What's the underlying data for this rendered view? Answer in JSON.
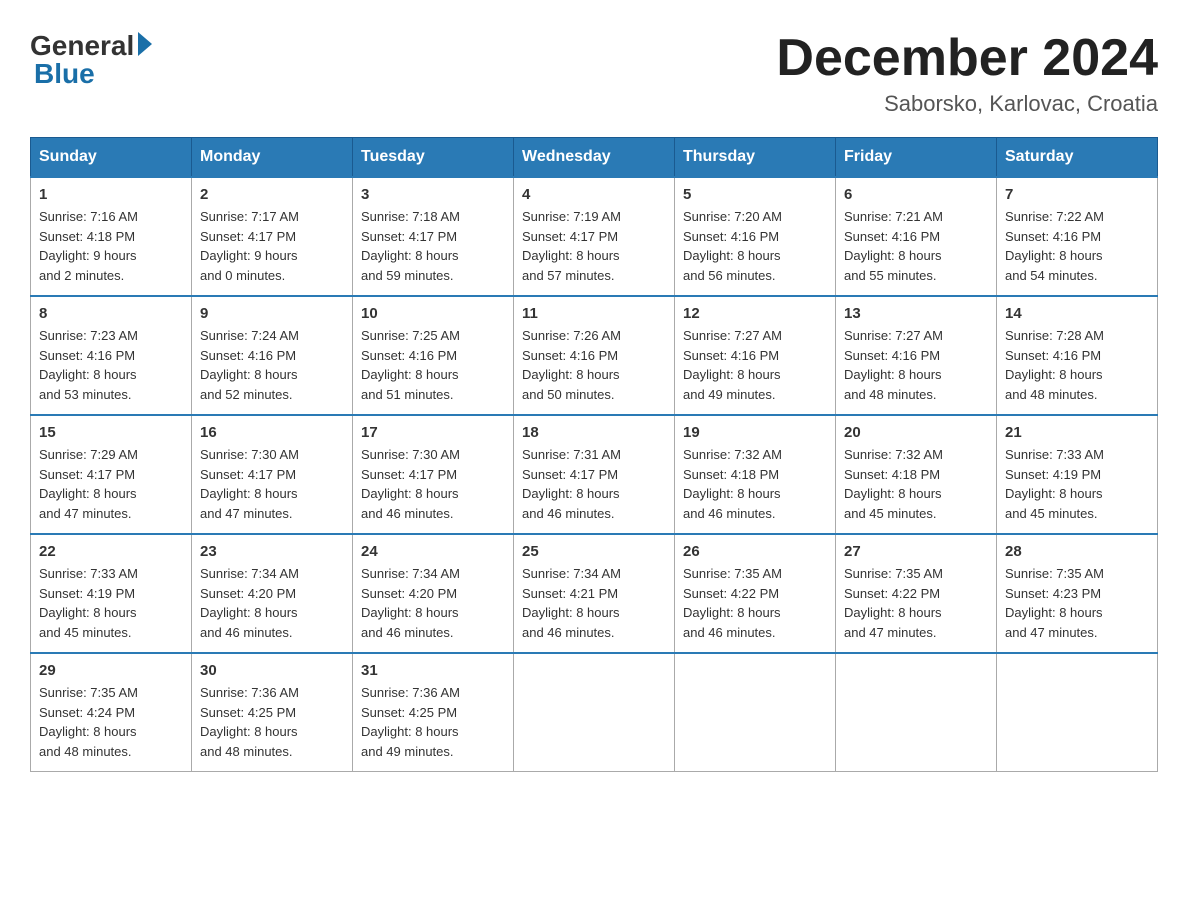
{
  "logo": {
    "general": "General",
    "blue": "Blue"
  },
  "title": {
    "month_year": "December 2024",
    "location": "Saborsko, Karlovac, Croatia"
  },
  "days_of_week": [
    "Sunday",
    "Monday",
    "Tuesday",
    "Wednesday",
    "Thursday",
    "Friday",
    "Saturday"
  ],
  "weeks": [
    [
      {
        "day": "1",
        "sunrise": "7:16 AM",
        "sunset": "4:18 PM",
        "daylight": "9 hours and 2 minutes."
      },
      {
        "day": "2",
        "sunrise": "7:17 AM",
        "sunset": "4:17 PM",
        "daylight": "9 hours and 0 minutes."
      },
      {
        "day": "3",
        "sunrise": "7:18 AM",
        "sunset": "4:17 PM",
        "daylight": "8 hours and 59 minutes."
      },
      {
        "day": "4",
        "sunrise": "7:19 AM",
        "sunset": "4:17 PM",
        "daylight": "8 hours and 57 minutes."
      },
      {
        "day": "5",
        "sunrise": "7:20 AM",
        "sunset": "4:16 PM",
        "daylight": "8 hours and 56 minutes."
      },
      {
        "day": "6",
        "sunrise": "7:21 AM",
        "sunset": "4:16 PM",
        "daylight": "8 hours and 55 minutes."
      },
      {
        "day": "7",
        "sunrise": "7:22 AM",
        "sunset": "4:16 PM",
        "daylight": "8 hours and 54 minutes."
      }
    ],
    [
      {
        "day": "8",
        "sunrise": "7:23 AM",
        "sunset": "4:16 PM",
        "daylight": "8 hours and 53 minutes."
      },
      {
        "day": "9",
        "sunrise": "7:24 AM",
        "sunset": "4:16 PM",
        "daylight": "8 hours and 52 minutes."
      },
      {
        "day": "10",
        "sunrise": "7:25 AM",
        "sunset": "4:16 PM",
        "daylight": "8 hours and 51 minutes."
      },
      {
        "day": "11",
        "sunrise": "7:26 AM",
        "sunset": "4:16 PM",
        "daylight": "8 hours and 50 minutes."
      },
      {
        "day": "12",
        "sunrise": "7:27 AM",
        "sunset": "4:16 PM",
        "daylight": "8 hours and 49 minutes."
      },
      {
        "day": "13",
        "sunrise": "7:27 AM",
        "sunset": "4:16 PM",
        "daylight": "8 hours and 48 minutes."
      },
      {
        "day": "14",
        "sunrise": "7:28 AM",
        "sunset": "4:16 PM",
        "daylight": "8 hours and 48 minutes."
      }
    ],
    [
      {
        "day": "15",
        "sunrise": "7:29 AM",
        "sunset": "4:17 PM",
        "daylight": "8 hours and 47 minutes."
      },
      {
        "day": "16",
        "sunrise": "7:30 AM",
        "sunset": "4:17 PM",
        "daylight": "8 hours and 47 minutes."
      },
      {
        "day": "17",
        "sunrise": "7:30 AM",
        "sunset": "4:17 PM",
        "daylight": "8 hours and 46 minutes."
      },
      {
        "day": "18",
        "sunrise": "7:31 AM",
        "sunset": "4:17 PM",
        "daylight": "8 hours and 46 minutes."
      },
      {
        "day": "19",
        "sunrise": "7:32 AM",
        "sunset": "4:18 PM",
        "daylight": "8 hours and 46 minutes."
      },
      {
        "day": "20",
        "sunrise": "7:32 AM",
        "sunset": "4:18 PM",
        "daylight": "8 hours and 45 minutes."
      },
      {
        "day": "21",
        "sunrise": "7:33 AM",
        "sunset": "4:19 PM",
        "daylight": "8 hours and 45 minutes."
      }
    ],
    [
      {
        "day": "22",
        "sunrise": "7:33 AM",
        "sunset": "4:19 PM",
        "daylight": "8 hours and 45 minutes."
      },
      {
        "day": "23",
        "sunrise": "7:34 AM",
        "sunset": "4:20 PM",
        "daylight": "8 hours and 46 minutes."
      },
      {
        "day": "24",
        "sunrise": "7:34 AM",
        "sunset": "4:20 PM",
        "daylight": "8 hours and 46 minutes."
      },
      {
        "day": "25",
        "sunrise": "7:34 AM",
        "sunset": "4:21 PM",
        "daylight": "8 hours and 46 minutes."
      },
      {
        "day": "26",
        "sunrise": "7:35 AM",
        "sunset": "4:22 PM",
        "daylight": "8 hours and 46 minutes."
      },
      {
        "day": "27",
        "sunrise": "7:35 AM",
        "sunset": "4:22 PM",
        "daylight": "8 hours and 47 minutes."
      },
      {
        "day": "28",
        "sunrise": "7:35 AM",
        "sunset": "4:23 PM",
        "daylight": "8 hours and 47 minutes."
      }
    ],
    [
      {
        "day": "29",
        "sunrise": "7:35 AM",
        "sunset": "4:24 PM",
        "daylight": "8 hours and 48 minutes."
      },
      {
        "day": "30",
        "sunrise": "7:36 AM",
        "sunset": "4:25 PM",
        "daylight": "8 hours and 48 minutes."
      },
      {
        "day": "31",
        "sunrise": "7:36 AM",
        "sunset": "4:25 PM",
        "daylight": "8 hours and 49 minutes."
      },
      null,
      null,
      null,
      null
    ]
  ],
  "labels": {
    "sunrise": "Sunrise:",
    "sunset": "Sunset:",
    "daylight": "Daylight:"
  }
}
